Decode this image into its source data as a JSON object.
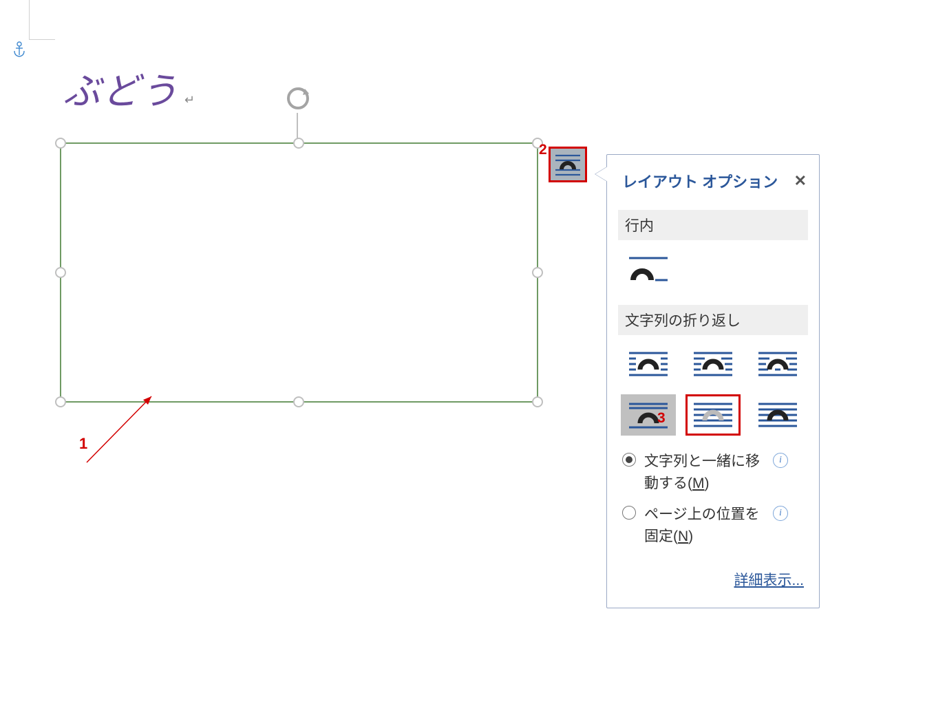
{
  "document": {
    "title_text": "ぶどう",
    "title_punct": "↵"
  },
  "annotations": {
    "label1": "1",
    "label2": "2",
    "label3": "3"
  },
  "layout_panel": {
    "title": "レイアウト オプション",
    "section_inline": "行内",
    "section_wrap": "文字列の折り返し",
    "radio_move": "文字列と一緒に移動する(",
    "radio_move_key": "M",
    "radio_move_suffix": ")",
    "radio_fix": "ページ上の位置を固定(",
    "radio_fix_key": "N",
    "radio_fix_suffix": ")",
    "details_link": "詳細表示..."
  }
}
